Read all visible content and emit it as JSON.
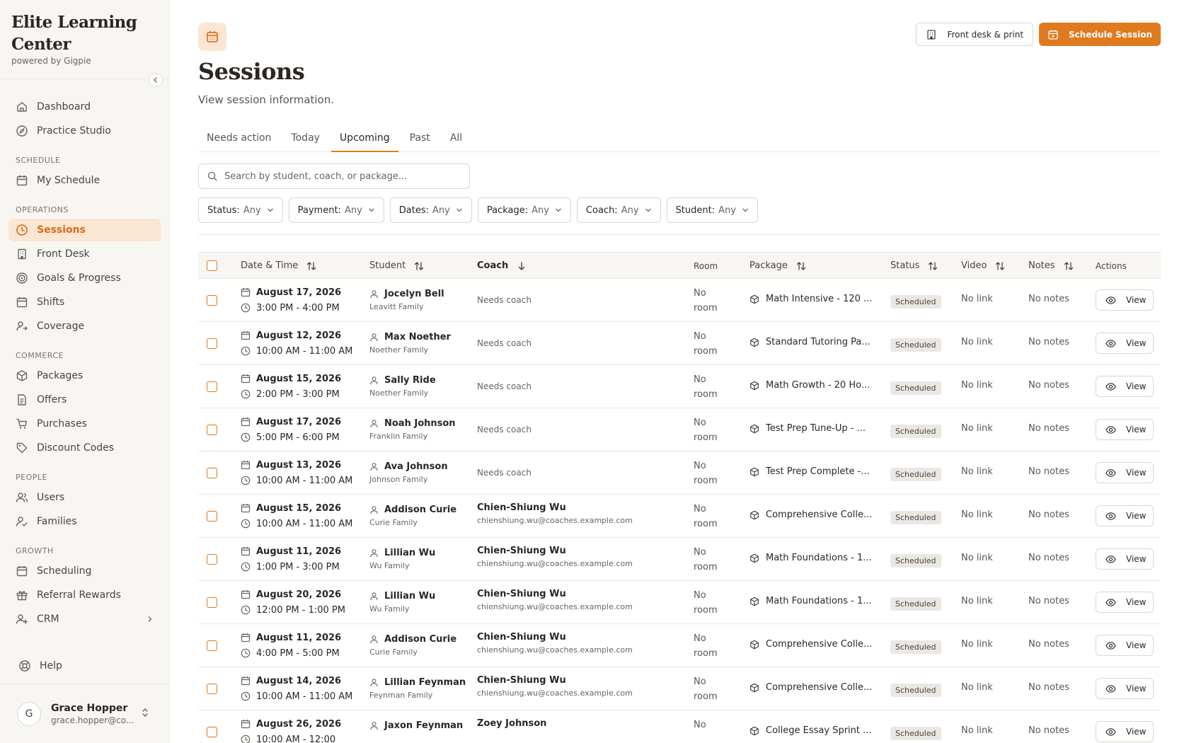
{
  "sidebar": {
    "brand_title": "Elite Learning Center",
    "brand_sub": "powered by Gigpie",
    "items_top": [
      {
        "label": "Dashboard",
        "icon": "home-icon"
      },
      {
        "label": "Practice Studio",
        "icon": "compass-icon"
      }
    ],
    "sections": [
      {
        "title": "SCHEDULE",
        "items": [
          {
            "label": "My Schedule",
            "icon": "calendar-icon"
          }
        ]
      },
      {
        "title": "OPERATIONS",
        "items": [
          {
            "label": "Sessions",
            "icon": "clock-icon",
            "active": true
          },
          {
            "label": "Front Desk",
            "icon": "building-icon"
          },
          {
            "label": "Goals & Progress",
            "icon": "target-icon"
          },
          {
            "label": "Shifts",
            "icon": "calendar-icon"
          },
          {
            "label": "Coverage",
            "icon": "user-swap-icon"
          }
        ]
      },
      {
        "title": "COMMERCE",
        "items": [
          {
            "label": "Packages",
            "icon": "package-icon"
          },
          {
            "label": "Offers",
            "icon": "document-icon"
          },
          {
            "label": "Purchases",
            "icon": "cart-icon"
          },
          {
            "label": "Discount Codes",
            "icon": "tag-icon"
          }
        ]
      },
      {
        "title": "PEOPLE",
        "items": [
          {
            "label": "Users",
            "icon": "users-icon"
          },
          {
            "label": "Families",
            "icon": "user-check-icon"
          }
        ]
      },
      {
        "title": "GROWTH",
        "items": [
          {
            "label": "Scheduling",
            "icon": "calendar-icon"
          },
          {
            "label": "Referral Rewards",
            "icon": "gift-icon"
          },
          {
            "label": "CRM",
            "icon": "user-plus-icon",
            "chevron": true
          }
        ]
      }
    ],
    "help": "Help",
    "user": {
      "initial": "G",
      "name": "Grace Hopper",
      "email": "grace.hopper@co..."
    }
  },
  "header": {
    "title": "Sessions",
    "subtitle": "View session information.",
    "front_desk_label": "Front desk & print",
    "schedule_label": "Schedule Session"
  },
  "tabs": [
    {
      "label": "Needs action"
    },
    {
      "label": "Today"
    },
    {
      "label": "Upcoming",
      "active": true
    },
    {
      "label": "Past"
    },
    {
      "label": "All"
    }
  ],
  "search": {
    "placeholder": "Search by student, coach, or package..."
  },
  "filters": [
    {
      "label": "Status:",
      "value": "Any"
    },
    {
      "label": "Payment:",
      "value": "Any"
    },
    {
      "label": "Dates:",
      "value": "Any"
    },
    {
      "label": "Package:",
      "value": "Any"
    },
    {
      "label": "Coach:",
      "value": "Any"
    },
    {
      "label": "Student:",
      "value": "Any"
    }
  ],
  "table": {
    "columns": {
      "datetime": "Date & Time",
      "student": "Student",
      "coach": "Coach",
      "room": "Room",
      "package": "Package",
      "status": "Status",
      "video": "Video",
      "notes": "Notes",
      "actions": "Actions"
    },
    "rows": [
      {
        "date": "August 17, 2026",
        "time": "3:00 PM - 4:00 PM",
        "student": "Jocelyn Bell",
        "family": "Leavitt Family",
        "coach": "",
        "coach_email": "",
        "coach_needs": "Needs coach",
        "room1": "No",
        "room2": "room",
        "package": "Math Intensive - 120 ...",
        "status": "Scheduled",
        "video": "No link",
        "notes": "No notes",
        "action": "View"
      },
      {
        "date": "August 12, 2026",
        "time": "10:00 AM - 11:00 AM",
        "student": "Max Noether",
        "family": "Noether Family",
        "coach": "",
        "coach_email": "",
        "coach_needs": "Needs coach",
        "room1": "No",
        "room2": "room",
        "package": "Standard Tutoring Pa...",
        "status": "Scheduled",
        "video": "No link",
        "notes": "No notes",
        "action": "View"
      },
      {
        "date": "August 15, 2026",
        "time": "2:00 PM - 3:00 PM",
        "student": "Sally Ride",
        "family": "Noether Family",
        "coach": "",
        "coach_email": "",
        "coach_needs": "Needs coach",
        "room1": "No",
        "room2": "room",
        "package": "Math Growth - 20 Ho...",
        "status": "Scheduled",
        "video": "No link",
        "notes": "No notes",
        "action": "View"
      },
      {
        "date": "August 17, 2026",
        "time": "5:00 PM - 6:00 PM",
        "student": "Noah Johnson",
        "family": "Franklin Family",
        "coach": "",
        "coach_email": "",
        "coach_needs": "Needs coach",
        "room1": "No",
        "room2": "room",
        "package": "Test Prep Tune-Up - ...",
        "status": "Scheduled",
        "video": "No link",
        "notes": "No notes",
        "action": "View"
      },
      {
        "date": "August 13, 2026",
        "time": "10:00 AM - 11:00 AM",
        "student": "Ava Johnson",
        "family": "Johnson Family",
        "coach": "",
        "coach_email": "",
        "coach_needs": "Needs coach",
        "room1": "No",
        "room2": "room",
        "package": "Test Prep Complete -...",
        "status": "Scheduled",
        "video": "No link",
        "notes": "No notes",
        "action": "View"
      },
      {
        "date": "August 15, 2026",
        "time": "10:00 AM - 11:00 AM",
        "student": "Addison Curie",
        "family": "Curie Family",
        "coach": "Chien-Shiung Wu",
        "coach_email": "chienshiung.wu@coaches.example.com",
        "coach_needs": "",
        "room1": "No",
        "room2": "room",
        "package": "Comprehensive Colle...",
        "status": "Scheduled",
        "video": "No link",
        "notes": "No notes",
        "action": "View"
      },
      {
        "date": "August 11, 2026",
        "time": "1:00 PM - 3:00 PM",
        "student": "Lillian Wu",
        "family": "Wu Family",
        "coach": "Chien-Shiung Wu",
        "coach_email": "chienshiung.wu@coaches.example.com",
        "coach_needs": "",
        "room1": "No",
        "room2": "room",
        "package": "Math Foundations - 1...",
        "status": "Scheduled",
        "video": "No link",
        "notes": "No notes",
        "action": "View"
      },
      {
        "date": "August 20, 2026",
        "time": "12:00 PM - 1:00 PM",
        "student": "Lillian Wu",
        "family": "Wu Family",
        "coach": "Chien-Shiung Wu",
        "coach_email": "chienshiung.wu@coaches.example.com",
        "coach_needs": "",
        "room1": "No",
        "room2": "room",
        "package": "Math Foundations - 1...",
        "status": "Scheduled",
        "video": "No link",
        "notes": "No notes",
        "action": "View"
      },
      {
        "date": "August 11, 2026",
        "time": "4:00 PM - 5:00 PM",
        "student": "Addison Curie",
        "family": "Curie Family",
        "coach": "Chien-Shiung Wu",
        "coach_email": "chienshiung.wu@coaches.example.com",
        "coach_needs": "",
        "room1": "No",
        "room2": "room",
        "package": "Comprehensive Colle...",
        "status": "Scheduled",
        "video": "No link",
        "notes": "No notes",
        "action": "View"
      },
      {
        "date": "August 14, 2026",
        "time": "10:00 AM - 11:00 AM",
        "student": "Lillian Feynman",
        "family": "Feynman Family",
        "coach": "Chien-Shiung Wu",
        "coach_email": "chienshiung.wu@coaches.example.com",
        "coach_needs": "",
        "room1": "No",
        "room2": "room",
        "package": "Comprehensive Colle...",
        "status": "Scheduled",
        "video": "No link",
        "notes": "No notes",
        "action": "View"
      },
      {
        "date": "August 26, 2026",
        "time": "10:00 AM - 12:00",
        "student": "Jaxon Feynman",
        "family": "",
        "coach": "Zoey Johnson",
        "coach_email": "",
        "coach_needs": "",
        "room1": "No",
        "room2": "",
        "package": "College Essay Sprint ...",
        "status": "Scheduled",
        "video": "No link",
        "notes": "No notes",
        "action": "View"
      }
    ]
  },
  "colors": {
    "accent": "#e07a1f",
    "active_bg": "#fbe6d3",
    "sidebar_bg": "#f8f6f3"
  }
}
